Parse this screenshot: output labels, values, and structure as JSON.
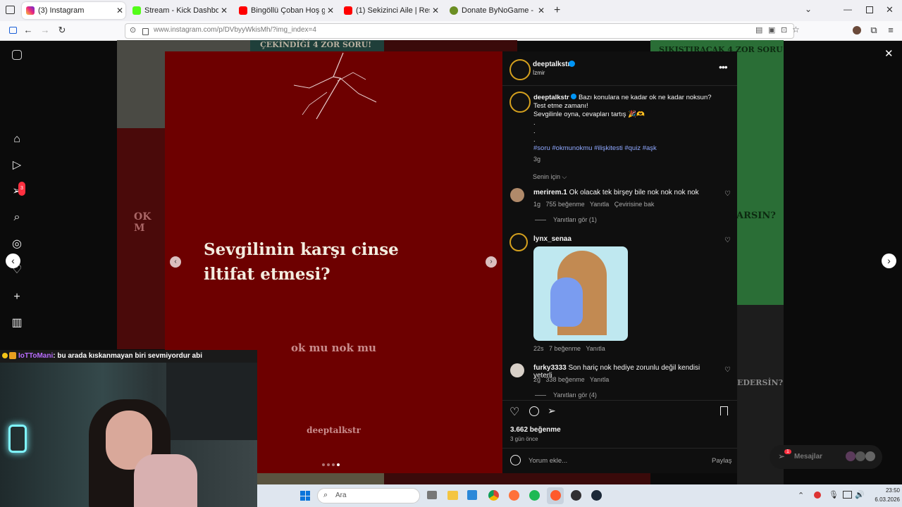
{
  "browser": {
    "tabs": [
      {
        "title": "(3) Instagram",
        "color": "#d62976",
        "active": true
      },
      {
        "title": "Stream - Kick Dashboard",
        "color": "#53fc18",
        "active": false
      },
      {
        "title": "Bingöllü Çoban Hoş geldiniz - Y",
        "color": "#ff0000",
        "active": false
      },
      {
        "title": "(1) Sekizinci Aile | Resmi Fragma",
        "color": "#ff0000",
        "active": false
      },
      {
        "title": "Donate ByNoGame - Gelen/Gid",
        "color": "#6b8e23",
        "active": false
      }
    ],
    "url": "www.instagram.com/p/DVbyyWkisMh/?img_index=4"
  },
  "post": {
    "image_question": "Sevgilinin karşı cinse iltifat etmesi?",
    "image_subtitle": "ok mu nok mu",
    "image_brand": "deeptalkstr",
    "carousel_dots": 4,
    "carousel_active_index": 3
  },
  "panel": {
    "username": "deeptalkstr",
    "location": "İzmir",
    "caption_user": "deeptalkstr",
    "caption_line1": "Bazı konulara ne kadar ok ne kadar noksun? Test etme zamanı!",
    "caption_line2": "Sevgilinle oyna, cevapları tartış 🎉🫶",
    "caption_dots": [
      ".",
      ".",
      "."
    ],
    "hashtags": "#soru #okmunokmu #ilişkitesti #quiz #aşk",
    "caption_time": "3g",
    "sort_label": "Senin için",
    "comments": [
      {
        "user": "merirem.1",
        "text": "Ok olacak tek birşey bile nok nok nok nok",
        "time": "1g",
        "likes": "755 beğenme",
        "reply": "Yanıtla",
        "translate": "Çevirisine bak",
        "view_replies": "Yanıtları gör (1)"
      },
      {
        "user": "lynx_senaa",
        "text": "",
        "time": "22s",
        "likes": "7 beğenme",
        "reply": "Yanıtla"
      },
      {
        "user": "furky3333",
        "text": "Son hariç nok hediye zorunlu değil kendisi yeterli",
        "time": "2g",
        "likes": "338 beğenme",
        "reply": "Yanıtla",
        "view_replies": "Yanıtları gör (4)"
      }
    ],
    "likes_total": "3.662 beğenme",
    "posted_ago": "3 gün önce",
    "comment_placeholder": "Yorum ekle...",
    "share_label": "Paylaş"
  },
  "background_tiles": {
    "t1": "ÇEKİNDİĞİ 4 ZOR SORU!",
    "t2": "SIKIŞTIRACAK 4 ZOR SORU",
    "t3": "OK M",
    "t4": "ARSIN?",
    "t5": "EDERSİN?"
  },
  "messages_widget": {
    "label": "Mesajlar",
    "badge": "1"
  },
  "sidebar_badge": "3",
  "stream": {
    "chat_user": "IoTToMani",
    "chat_text": ": bu arada kıskanmayan biri sevmiyordur abi"
  },
  "taskbar": {
    "search_placeholder": "Ara",
    "time": "23:50",
    "date": "6.03.2026"
  }
}
